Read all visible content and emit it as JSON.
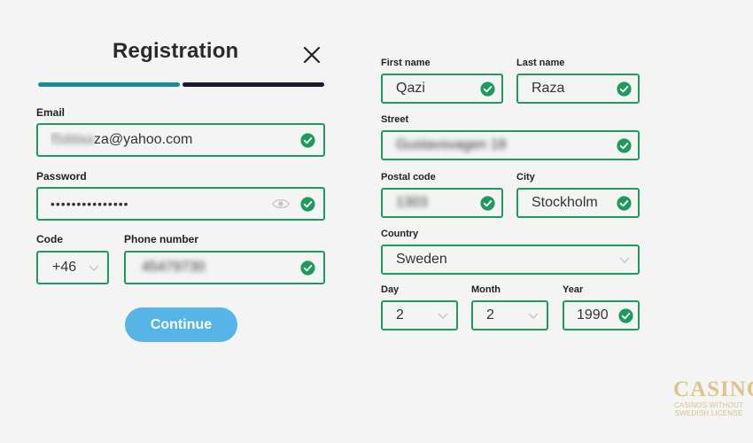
{
  "header": {
    "title": "Registration",
    "close_icon": "close-icon"
  },
  "progress": {
    "step": 1,
    "total": 2,
    "colors": {
      "active": "#1a8b95",
      "pending": "#1a1a2b"
    }
  },
  "left": {
    "email": {
      "label": "Email",
      "value_hidden": "f5ddaa",
      "value_visible": "za@yahoo.com"
    },
    "password": {
      "label": "Password",
      "value": "•••••••••••••••"
    },
    "code": {
      "label": "Code",
      "value": "+46"
    },
    "phone": {
      "label": "Phone number",
      "value": "45479730"
    },
    "continue_label": "Continue"
  },
  "right": {
    "first_name": {
      "label": "First name",
      "value": "Qazi"
    },
    "last_name": {
      "label": "Last name",
      "value": "Raza"
    },
    "street": {
      "label": "Street",
      "value": "Gustavsvagen 18"
    },
    "postal_code": {
      "label": "Postal code",
      "value": "1303"
    },
    "city": {
      "label": "City",
      "value": "Stockholm"
    },
    "country": {
      "label": "Country",
      "value": "Sweden"
    },
    "day": {
      "label": "Day",
      "value": "2"
    },
    "month": {
      "label": "Month",
      "value": "2"
    },
    "year": {
      "label": "Year",
      "value": "1990"
    }
  },
  "watermark": {
    "brand": "CASINOS",
    "tagline_1": "CASINOS WITHOUT",
    "tagline_2": "SWEDISH LICENSE"
  },
  "colors": {
    "valid_border": "#1d9a5c",
    "check": "#1d9a5c",
    "button": "#56b4e6"
  }
}
